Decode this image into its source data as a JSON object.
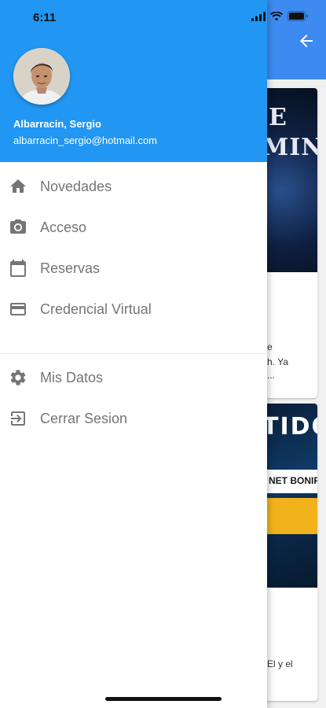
{
  "status_bar": {
    "time": "6:11"
  },
  "drawer": {
    "user": {
      "name": "Albarracin, Sergio",
      "email": "albarracin_sergio@hotmail.com"
    },
    "items": [
      {
        "label": "Novedades",
        "icon": "home-icon"
      },
      {
        "label": "Acceso",
        "icon": "camera-icon"
      },
      {
        "label": "Reservas",
        "icon": "calendar-icon"
      },
      {
        "label": "Credencial Virtual",
        "icon": "credit-card-icon"
      },
      {
        "label": "Mis Datos",
        "icon": "gear-icon"
      },
      {
        "label": "Cerrar Sesion",
        "icon": "logout-icon"
      }
    ]
  },
  "background": {
    "card1": {
      "title_line1": "E",
      "title_line2": "MING",
      "text_line1": "e",
      "text_line2": "h. Ya",
      "text_line3": "..."
    },
    "card2": {
      "title": "TIDO",
      "band": "NET BONIFICA",
      "text_line1": "El y el"
    }
  },
  "colors": {
    "header": "#2196f3",
    "appbar": "#3d8bf0",
    "menu_text": "#757575"
  }
}
